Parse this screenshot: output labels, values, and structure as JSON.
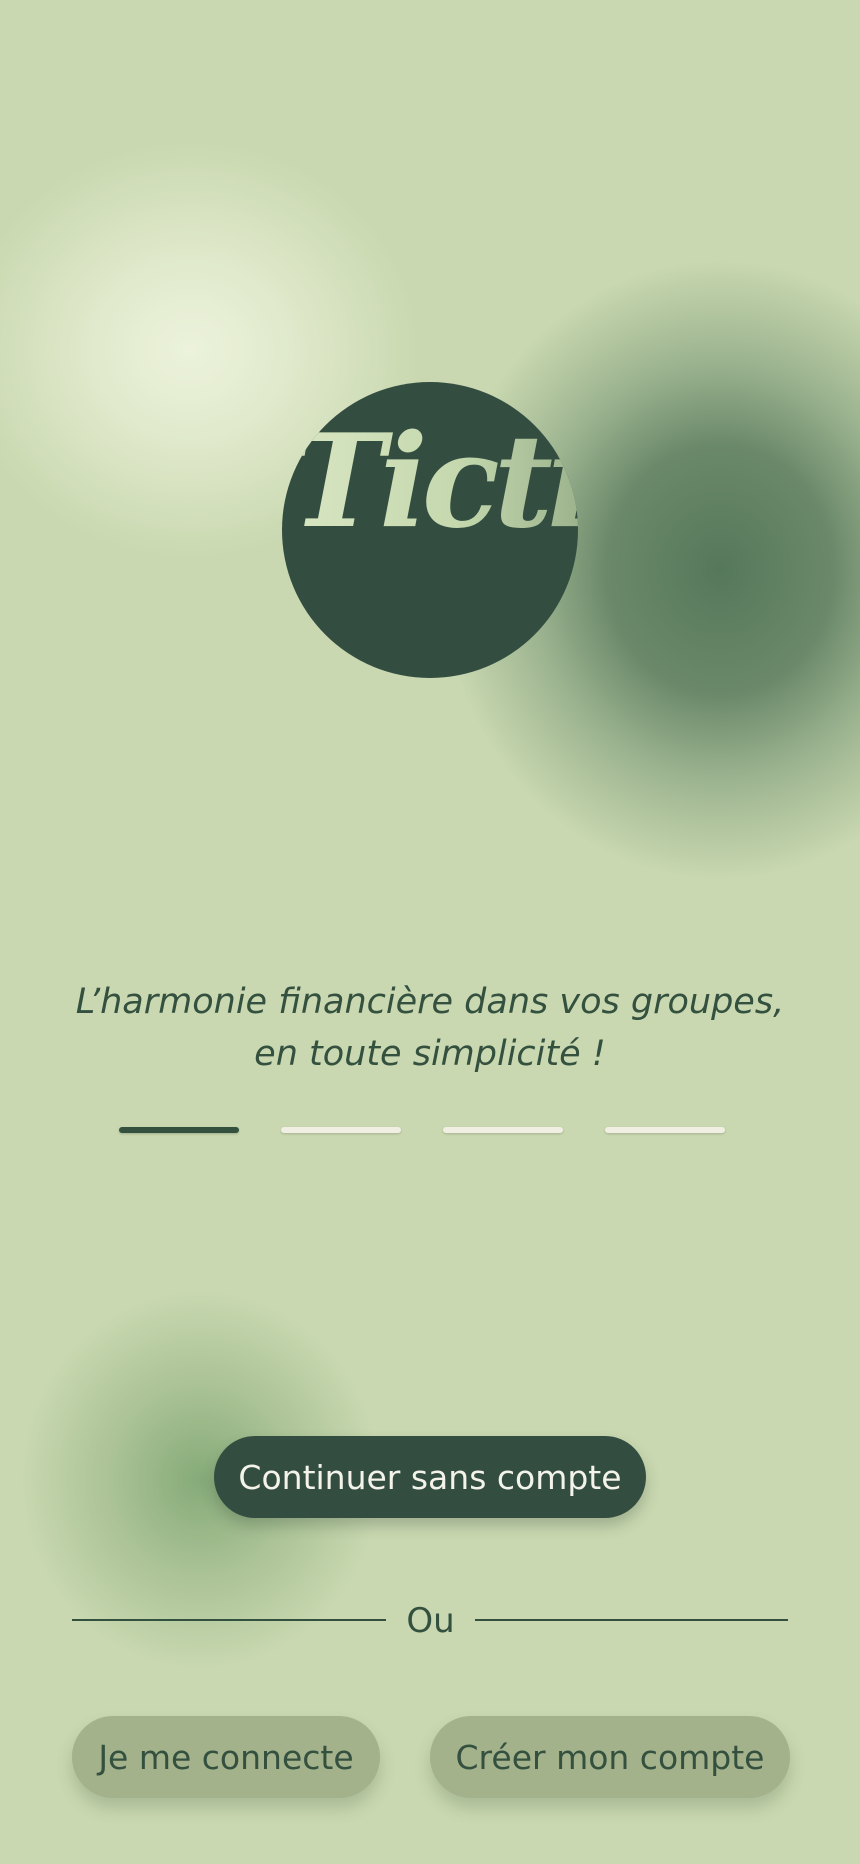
{
  "logo": {
    "text": "Tictic",
    "background_color": "#334e41"
  },
  "tagline": "L’harmonie financière dans vos groupes, en toute simplicité !",
  "pager": {
    "count": 4,
    "active_index": 0
  },
  "actions": {
    "continue_without_account": "Continuer sans compte",
    "separator": "Ou",
    "login": "Je me connecte",
    "signup": "Créer mon compte"
  },
  "colors": {
    "background": "#c9d8b0",
    "primary": "#334e41",
    "secondary_button": "#a4b28b",
    "inactive_indicator": "#f1efe4"
  }
}
